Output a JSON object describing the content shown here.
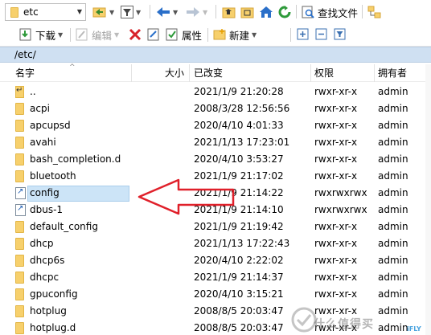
{
  "toolbar1": {
    "path_combo_value": "etc",
    "find_files_label": "查找文件"
  },
  "toolbar2": {
    "download_label": "下载",
    "edit_label": "编辑",
    "properties_label": "属性",
    "new_label": "新建"
  },
  "path": "/etc/",
  "columns": {
    "name": "名字",
    "size": "大小",
    "modified": "已改变",
    "permissions": "权限",
    "owner": "拥有者"
  },
  "rows": [
    {
      "name": "..",
      "date": "2021/1/9 21:20:28",
      "perm": "rwxr-xr-x",
      "owner": "admin",
      "type": "parent"
    },
    {
      "name": "acpi",
      "date": "2008/3/28 12:56:56",
      "perm": "rwxr-xr-x",
      "owner": "admin",
      "type": "folder"
    },
    {
      "name": "apcupsd",
      "date": "2020/4/10 4:01:33",
      "perm": "rwxr-xr-x",
      "owner": "admin",
      "type": "folder"
    },
    {
      "name": "avahi",
      "date": "2021/1/13 17:23:01",
      "perm": "rwxr-xr-x",
      "owner": "admin",
      "type": "folder"
    },
    {
      "name": "bash_completion.d",
      "date": "2020/4/10 3:53:27",
      "perm": "rwxr-xr-x",
      "owner": "admin",
      "type": "folder"
    },
    {
      "name": "bluetooth",
      "date": "2021/1/9 21:17:02",
      "perm": "rwxr-xr-x",
      "owner": "admin",
      "type": "folder"
    },
    {
      "name": "config",
      "date": "2021/1/9 21:14:22",
      "perm": "rwxrwxrwx",
      "owner": "admin",
      "type": "link"
    },
    {
      "name": "dbus-1",
      "date": "2021/1/9 21:14:10",
      "perm": "rwxrwxrwx",
      "owner": "admin",
      "type": "link"
    },
    {
      "name": "default_config",
      "date": "2021/1/9 21:19:42",
      "perm": "rwxr-xr-x",
      "owner": "admin",
      "type": "folder"
    },
    {
      "name": "dhcp",
      "date": "2021/1/13 17:22:43",
      "perm": "rwxr-xr-x",
      "owner": "admin",
      "type": "folder"
    },
    {
      "name": "dhcp6s",
      "date": "2020/4/10 2:22:02",
      "perm": "rwxr-xr-x",
      "owner": "admin",
      "type": "folder"
    },
    {
      "name": "dhcpc",
      "date": "2021/1/9 21:14:37",
      "perm": "rwxr-xr-x",
      "owner": "admin",
      "type": "folder"
    },
    {
      "name": "gpuconfig",
      "date": "2020/4/10 3:15:21",
      "perm": "rwxr-xr-x",
      "owner": "admin",
      "type": "folder"
    },
    {
      "name": "hotplug",
      "date": "2008/8/5 20:03:47",
      "perm": "rwxr-xr-x",
      "owner": "admin",
      "type": "folder"
    },
    {
      "name": "hotplug.d",
      "date": "2008/8/5 20:03:47",
      "perm": "rwxr-xr-x",
      "owner": "admin",
      "type": "folder"
    }
  ],
  "selected_row": "config",
  "watermark": {
    "text": "什么值得买",
    "sub": "iFLY"
  },
  "colors": {
    "path_bar": "#cfe0f2",
    "selection": "#cce4f7",
    "arrow": "#e0202a",
    "folder": "#f7d06c"
  }
}
